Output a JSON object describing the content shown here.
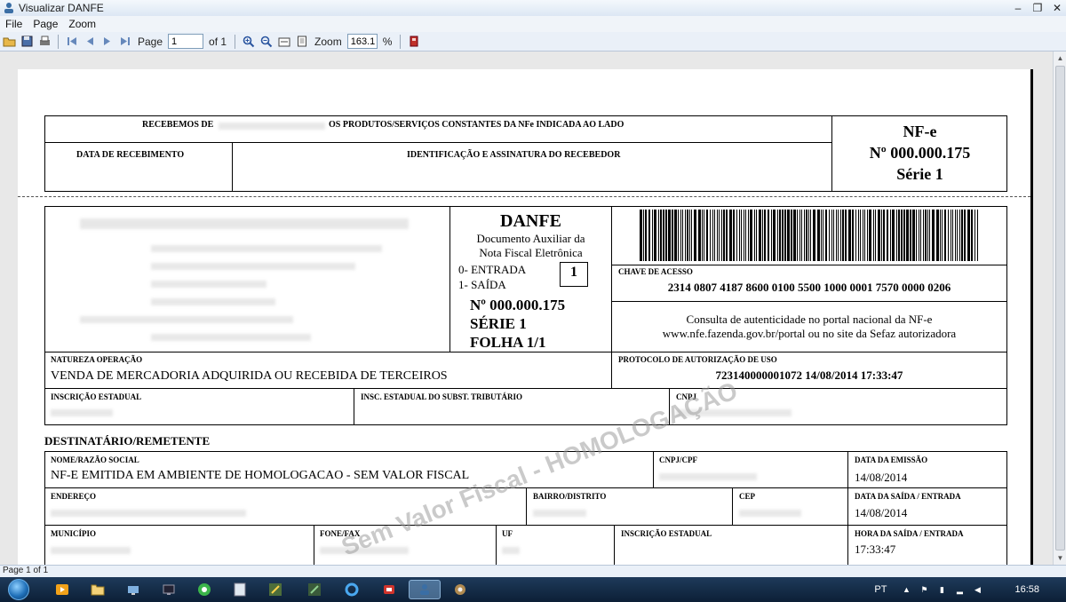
{
  "window": {
    "title": "Visualizar DANFE"
  },
  "menu": {
    "items": [
      "File",
      "Page",
      "Zoom"
    ]
  },
  "toolbar": {
    "page_label": "Page",
    "page_value": "1",
    "page_of": "of 1",
    "zoom_label": "Zoom",
    "zoom_value": "163.1",
    "zoom_unit": "%"
  },
  "canhoto": {
    "recebemos": "RECEBEMOS DE",
    "recebemos_tail": "OS PRODUTOS/SERVIÇOS CONSTANTES  DA NFe INDICADA AO LADO",
    "data_recebimento": "DATA  DE  RECEBIMENTO",
    "identificacao": "IDENTIFICAÇÃO  E  ASSINATURA  DO  RECEBEDOR",
    "nfe_title": "NF-e",
    "nfe_numero": "Nº 000.000.175",
    "nfe_serie": "Série 1"
  },
  "danfe": {
    "title": "DANFE",
    "subtitle_1": "Documento Auxiliar da",
    "subtitle_2": "Nota Fiscal Eletrônica",
    "entrada": "0-  ENTRADA",
    "saida": "1-  SAÍDA",
    "tipo": "1",
    "numero": "Nº 000.000.175",
    "serie": "SÉRIE 1",
    "folha": "FOLHA 1/1"
  },
  "chave": {
    "label": "CHAVE DE ACESSO",
    "value": "2314 0807 4187 8600 0100 5500 1000 0001 7570 0000 0206"
  },
  "consulta": {
    "line1": "Consulta de autenticidade no portal nacional da NF-e",
    "line2": "www.nfe.fazenda.gov.br/portal ou no site da Sefaz autorizadora"
  },
  "natureza": {
    "label": "NATUREZA OPERAÇÃO",
    "value": "VENDA DE MERCADORIA ADQUIRIDA OU RECEBIDA DE TERCEIROS"
  },
  "protocolo": {
    "label": "PROTOCOLO DE AUTORIZAÇÃO DE USO",
    "value": "723140000001072 14/08/2014 17:33:47"
  },
  "inscricao": {
    "ie_label": "INSCRIÇÃO ESTADUAL",
    "ie_st_label": "INSC. ESTADUAL DO SUBST. TRIBUTÁRIO",
    "cnpj_label": "CNPJ"
  },
  "destinatario": {
    "section_title": "DESTINATÁRIO/REMETENTE",
    "nome_label": "NOME/RAZÃO SOCIAL",
    "nome_value": "NF-E EMITIDA EM AMBIENTE DE HOMOLOGACAO - SEM VALOR FISCAL",
    "cnpj_label": "CNPJ/CPF",
    "data_emissao_label": "DATA DA EMISSÃO",
    "data_emissao_value": "14/08/2014",
    "endereco_label": "ENDEREÇO",
    "bairro_label": "BAIRRO/DISTRITO",
    "cep_label": "CEP",
    "data_saida_label": "DATA DA SAÍDA / ENTRADA",
    "data_saida_value": "14/08/2014",
    "municipio_label": "MUNICÍPIO",
    "fone_label": "FONE/FAX",
    "uf_label": "UF",
    "ie_label": "INSCRIÇÃO ESTADUAL",
    "hora_saida_label": "HORA DA SAÍDA / ENTRADA",
    "hora_saida_value": "17:33:47"
  },
  "watermark": "Sem Valor Fiscal - HOMOLOGAÇÃO",
  "status": {
    "text": "Page 1 of 1"
  },
  "taskbar": {
    "lang": "PT",
    "clock": "16:58"
  }
}
